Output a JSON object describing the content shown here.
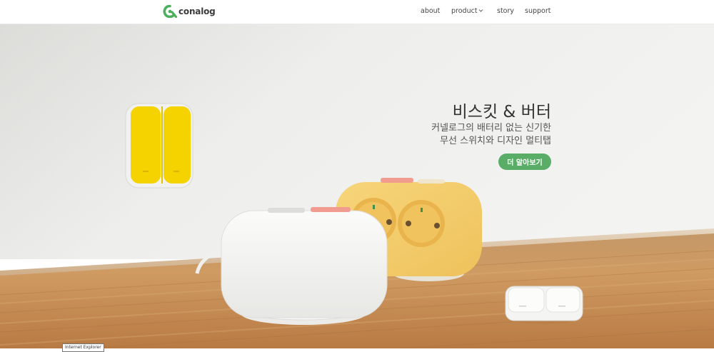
{
  "header": {
    "logo_text": "conalog",
    "nav": {
      "about": "about",
      "product": "product",
      "story": "story",
      "support": "support"
    }
  },
  "hero": {
    "title": "비스킷 & 버터",
    "subtitle_line1": "커넬로그의 배터리 없는 신기한",
    "subtitle_line2": "무선 스위치와 디자인 멀티탭",
    "cta_label": "더 알아보기"
  },
  "tooltip": "Internet Explorer",
  "colors": {
    "accent": "#5aad67",
    "logo_green": "#4caf5c",
    "switch_yellow": "#f5d300",
    "butter_yellow": "#f6cf6e",
    "biscuit_white": "#f4f4f2",
    "wood": "#c8925a"
  },
  "icons": {
    "logo": "conalog-logo-icon",
    "product_dropdown": "chevron-down-icon"
  }
}
